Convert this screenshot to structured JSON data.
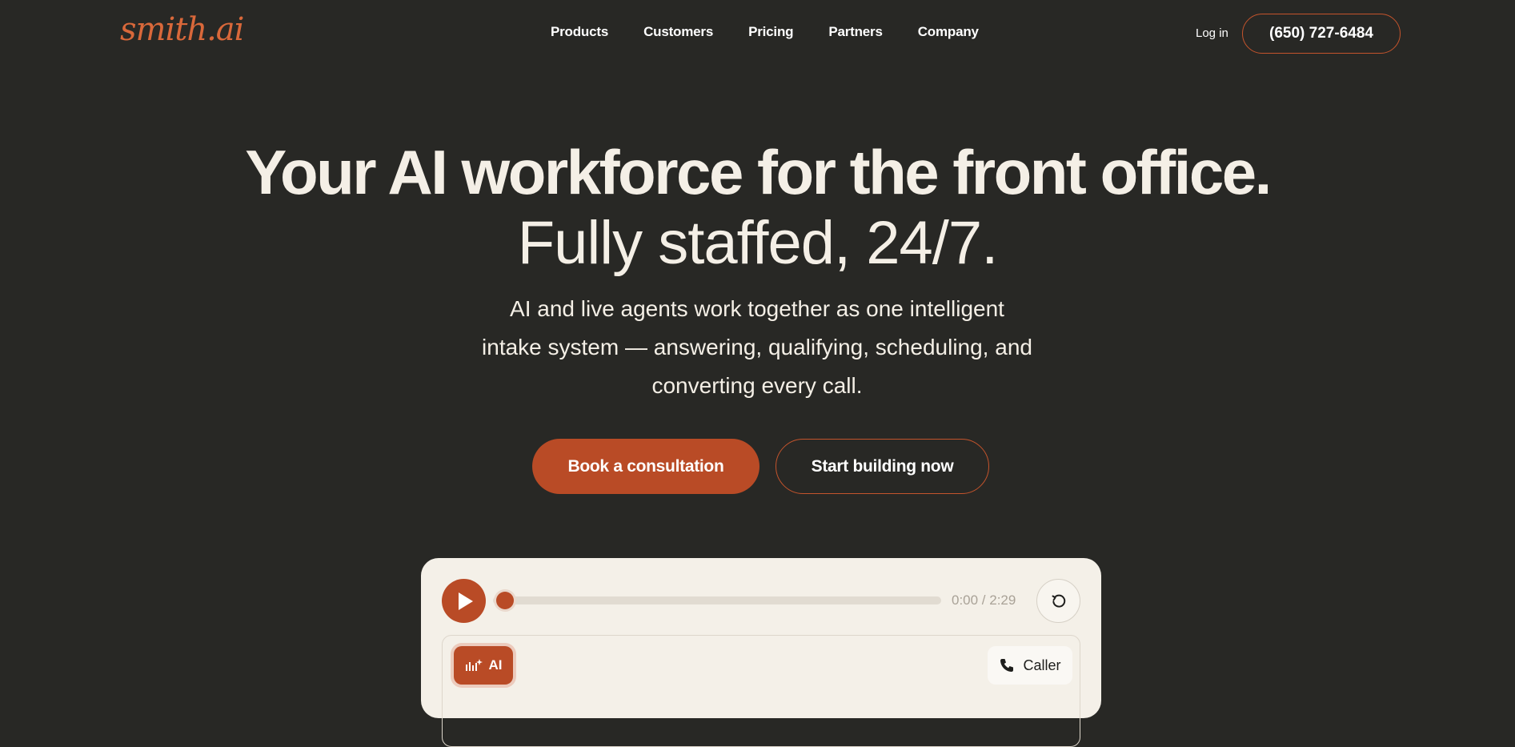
{
  "header": {
    "logo_text": "smith.ai",
    "nav": [
      "Products",
      "Customers",
      "Pricing",
      "Partners",
      "Company"
    ],
    "login_label": "Log in",
    "phone_label": "(650) 727-6484"
  },
  "hero": {
    "title": "Your AI workforce for the front office.",
    "subtitle": "Fully staffed, 24/7.",
    "description": "AI and live agents work together as one intelligent intake system — answering, qualifying, scheduling, and converting every call.",
    "primary_cta": "Book a consultation",
    "secondary_cta": "Start building now"
  },
  "player": {
    "time": "0:00 / 2:29",
    "progress": 0,
    "ai_label": "AI",
    "caller_label": "Caller"
  },
  "colors": {
    "background": "#282825",
    "accent": "#b94b26",
    "card": "#f4f0e8",
    "text_light": "#f4efe6"
  },
  "icons": [
    "play-icon",
    "replay-icon",
    "ai-waveform-icon",
    "phone-icon"
  ]
}
